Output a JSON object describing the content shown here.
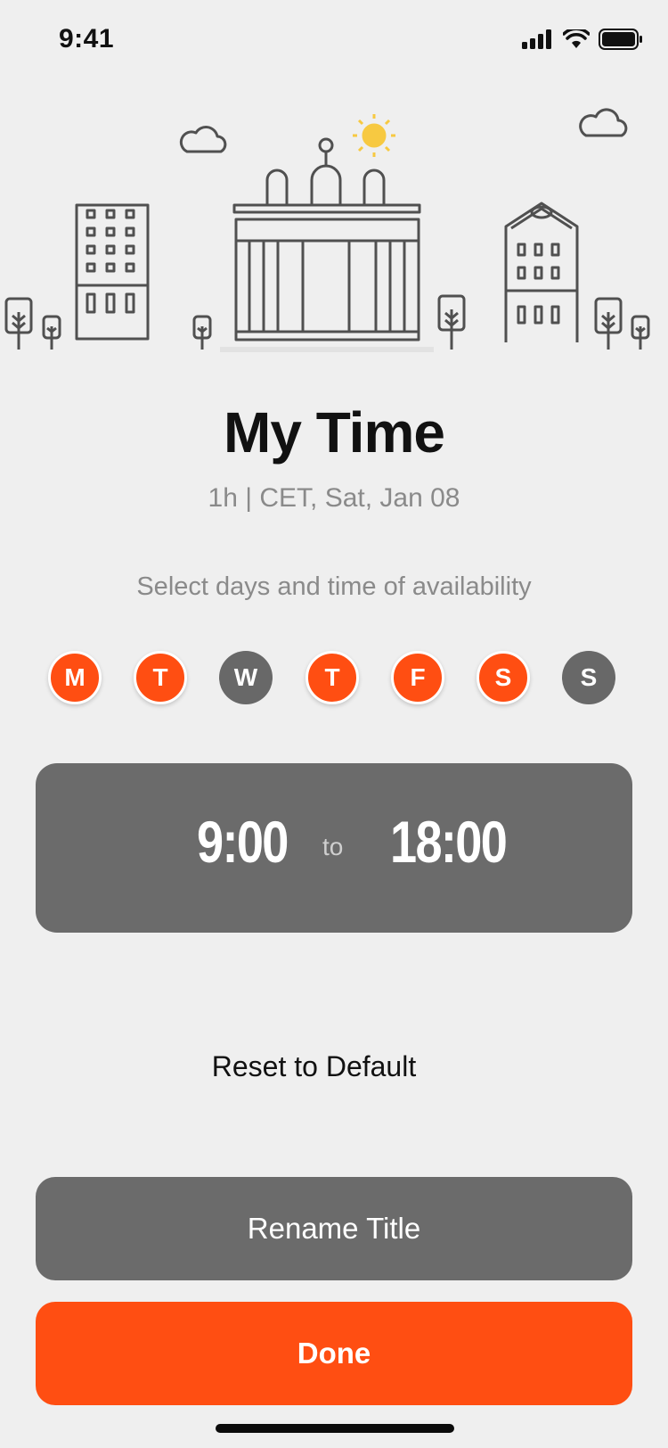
{
  "status_bar": {
    "time": "9:41"
  },
  "header": {
    "title": "My Time",
    "subtitle": "1h | CET, Sat, Jan 08"
  },
  "instruction": "Select days and time of availability",
  "days": [
    {
      "label": "M",
      "selected": true
    },
    {
      "label": "T",
      "selected": true
    },
    {
      "label": "W",
      "selected": false
    },
    {
      "label": "T",
      "selected": true
    },
    {
      "label": "F",
      "selected": true
    },
    {
      "label": "S",
      "selected": true
    },
    {
      "label": "S",
      "selected": false
    }
  ],
  "time_range": {
    "start": "9:00",
    "separator": "to",
    "end": "18:00"
  },
  "actions": {
    "reset_label": "Reset to Default",
    "rename_label": "Rename Title",
    "done_label": "Done"
  },
  "colors": {
    "accent": "#ff4e12",
    "inactive": "#686868",
    "background": "#efefef",
    "sun": "#f7c941"
  },
  "icons": [
    "signal-icon",
    "wifi-icon",
    "battery-icon",
    "cloud-icon",
    "sun-icon",
    "building-icon",
    "tree-icon"
  ]
}
